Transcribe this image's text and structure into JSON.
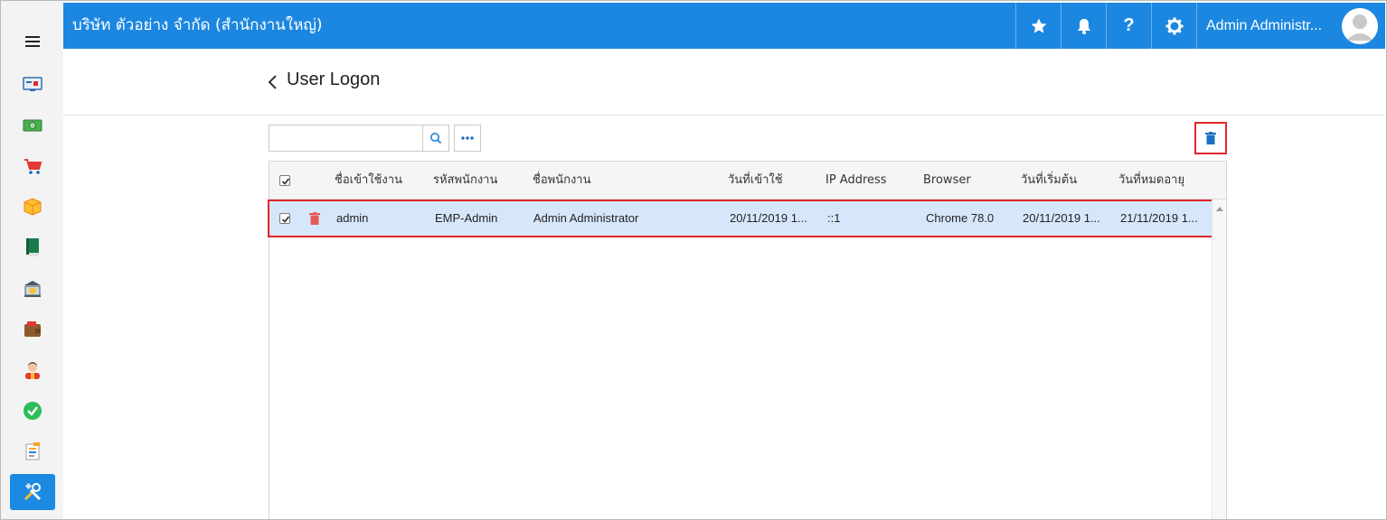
{
  "header": {
    "company": "บริษัท ตัวอย่าง จำกัด (สำนักงานใหญ่)",
    "user_name": "Admin Administr...",
    "brand_color": "#1b87e0",
    "icons": [
      "star-icon",
      "bell-icon",
      "help-icon",
      "gear-icon",
      "avatar"
    ]
  },
  "sidebar": {
    "items": [
      {
        "icon": "menu-icon"
      },
      {
        "icon": "dashboard-icon"
      },
      {
        "icon": "money-icon"
      },
      {
        "icon": "cart-icon"
      },
      {
        "icon": "box-icon"
      },
      {
        "icon": "book-icon"
      },
      {
        "icon": "bank-icon"
      },
      {
        "icon": "wallet-icon"
      },
      {
        "icon": "person-icon"
      },
      {
        "icon": "check-icon"
      },
      {
        "icon": "document-icon"
      },
      {
        "icon": "tools-icon",
        "active": true
      }
    ]
  },
  "page": {
    "title": "User Logon"
  },
  "toolbar": {
    "search_value": "",
    "search_placeholder": ""
  },
  "grid": {
    "columns": [
      "ชื่อเข้าใช้งาน",
      "รหัสพนักงาน",
      "ชื่อพนักงาน",
      "วันที่เข้าใช้",
      "IP Address",
      "Browser",
      "วันที่เริ่มต้น",
      "วันที่หมดอายุ"
    ],
    "rows": [
      {
        "checked": true,
        "selected": true,
        "username": "admin",
        "employee_code": "EMP-Admin",
        "employee_name": "Admin Administrator",
        "login_date": "20/11/2019 1...",
        "ip_address": "::1",
        "browser": "Chrome 78.0",
        "start_date": "20/11/2019 1...",
        "expire_date": "21/11/2019 1..."
      }
    ],
    "header_checked": true,
    "selection_color": "#d7e7fb",
    "highlight_color": "#e0262b"
  }
}
